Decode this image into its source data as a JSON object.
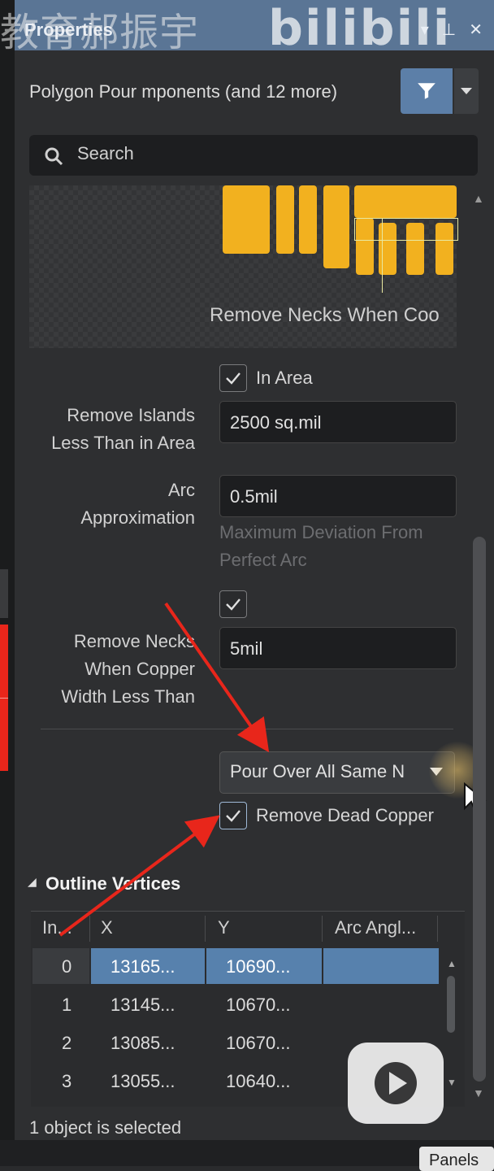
{
  "titlebar": {
    "title": "Properties",
    "watermark": "教育郝振宇",
    "watermark_brand": "bilibili"
  },
  "filter": {
    "label": "Polygon Pour   mponents (and 12 more)"
  },
  "search": {
    "placeholder": "Search"
  },
  "preview": {
    "caption": "Remove Necks When Coo"
  },
  "form": {
    "in_area_label": "In Area",
    "remove_islands_label_1": "Remove Islands",
    "remove_islands_label_2": "Less Than in Area",
    "remove_islands_value": "2500 sq.mil",
    "arc_label_1": "Arc",
    "arc_label_2": "Approximation",
    "arc_value": "0.5mil",
    "arc_hint_1": "Maximum Deviation From",
    "arc_hint_2": "Perfect Arc",
    "necks_label_1": "Remove Necks",
    "necks_label_2": "When Copper",
    "necks_label_3": "Width Less Than",
    "necks_value": "5mil",
    "pour_over_value": "Pour Over All Same N",
    "remove_dead_copper_label": "Remove Dead Copper"
  },
  "outline": {
    "title": "Outline Vertices",
    "columns": [
      "In...",
      "X",
      "Y",
      "Arc Angl..."
    ],
    "rows": [
      {
        "index": "0",
        "x": "13165...",
        "y": "10690...",
        "arc": ""
      },
      {
        "index": "1",
        "x": "13145...",
        "y": "10670...",
        "arc": ""
      },
      {
        "index": "2",
        "x": "13085...",
        "y": "10670...",
        "arc": ""
      },
      {
        "index": "3",
        "x": "13055...",
        "y": "10640...",
        "arc": ""
      }
    ]
  },
  "status": {
    "text": "1 object is selected"
  },
  "bottom": {
    "panels_label": "Panels"
  },
  "colors": {
    "accent": "#5781ad",
    "titlebar": "#5a7595",
    "pad_yellow": "#f2b11f",
    "arrow_red": "#e8261b"
  }
}
